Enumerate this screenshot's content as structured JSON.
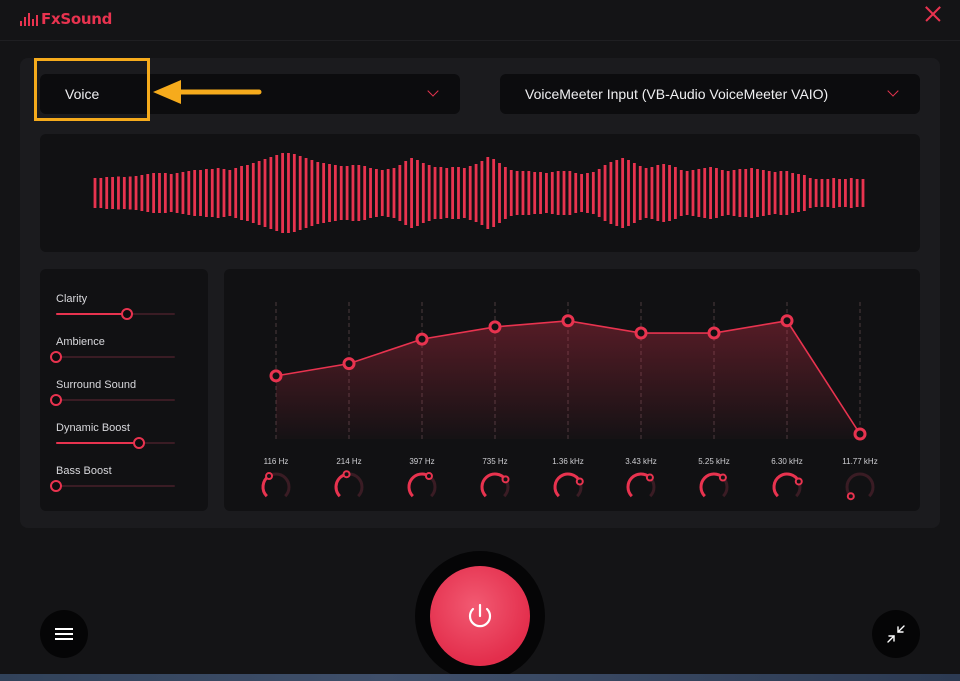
{
  "app": {
    "title": "FxSound",
    "accent_color": "#e8334f",
    "close_icon": "close-icon"
  },
  "preset": {
    "selected": "Voice"
  },
  "output_device": {
    "selected": "VoiceMeeter Input (VB-Audio VoiceMeeter VAIO)"
  },
  "annotation": {
    "highlight_color": "#f6ab1c",
    "arrow_color": "#f6ab1c"
  },
  "visualizer": {
    "color": "#e8334f",
    "levels": [
      0.3,
      0.3,
      0.32,
      0.32,
      0.33,
      0.32,
      0.33,
      0.34,
      0.36,
      0.38,
      0.4,
      0.4,
      0.4,
      0.38,
      0.4,
      0.42,
      0.44,
      0.46,
      0.46,
      0.48,
      0.48,
      0.5,
      0.48,
      0.46,
      0.5,
      0.54,
      0.56,
      0.6,
      0.64,
      0.68,
      0.72,
      0.76,
      0.8,
      0.8,
      0.78,
      0.74,
      0.7,
      0.66,
      0.62,
      0.6,
      0.58,
      0.56,
      0.54,
      0.54,
      0.56,
      0.56,
      0.54,
      0.5,
      0.48,
      0.46,
      0.48,
      0.5,
      0.56,
      0.64,
      0.7,
      0.66,
      0.6,
      0.56,
      0.52,
      0.52,
      0.5,
      0.52,
      0.52,
      0.5,
      0.54,
      0.58,
      0.64,
      0.72,
      0.68,
      0.6,
      0.52,
      0.46,
      0.44,
      0.44,
      0.44,
      0.42,
      0.42,
      0.4,
      0.42,
      0.44,
      0.44,
      0.44,
      0.4,
      0.38,
      0.4,
      0.42,
      0.48,
      0.56,
      0.62,
      0.66,
      0.7,
      0.66,
      0.6,
      0.54,
      0.5,
      0.52,
      0.56,
      0.58,
      0.56,
      0.52,
      0.46,
      0.44,
      0.46,
      0.48,
      0.5,
      0.52,
      0.5,
      0.46,
      0.44,
      0.46,
      0.48,
      0.48,
      0.5,
      0.48,
      0.46,
      0.44,
      0.42,
      0.44,
      0.44,
      0.4,
      0.38,
      0.36,
      0.3,
      0.28,
      0.28,
      0.28,
      0.3,
      0.28,
      0.28,
      0.3,
      0.28,
      0.28
    ]
  },
  "effects": [
    {
      "label": "Clarity",
      "value": 0.6
    },
    {
      "label": "Ambience",
      "value": 0.0
    },
    {
      "label": "Surround Sound",
      "value": 0.0
    },
    {
      "label": "Dynamic Boost",
      "value": 0.7
    },
    {
      "label": "Bass Boost",
      "value": 0.0
    }
  ],
  "eq": {
    "bands": [
      {
        "freq": "116 Hz",
        "level": 0.38
      },
      {
        "freq": "214 Hz",
        "level": 0.46
      },
      {
        "freq": "397 Hz",
        "level": 0.62
      },
      {
        "freq": "735 Hz",
        "level": 0.7
      },
      {
        "freq": "1.36 kHz",
        "level": 0.74
      },
      {
        "freq": "3.43 kHz",
        "level": 0.66
      },
      {
        "freq": "5.25 kHz",
        "level": 0.66
      },
      {
        "freq": "6.30 kHz",
        "level": 0.74
      },
      {
        "freq": "11.77 kHz",
        "level": 0.0
      }
    ]
  },
  "controls": {
    "menu_icon": "hamburger-menu-icon",
    "power_icon": "power-icon",
    "shrink_icon": "shrink-window-icon"
  }
}
